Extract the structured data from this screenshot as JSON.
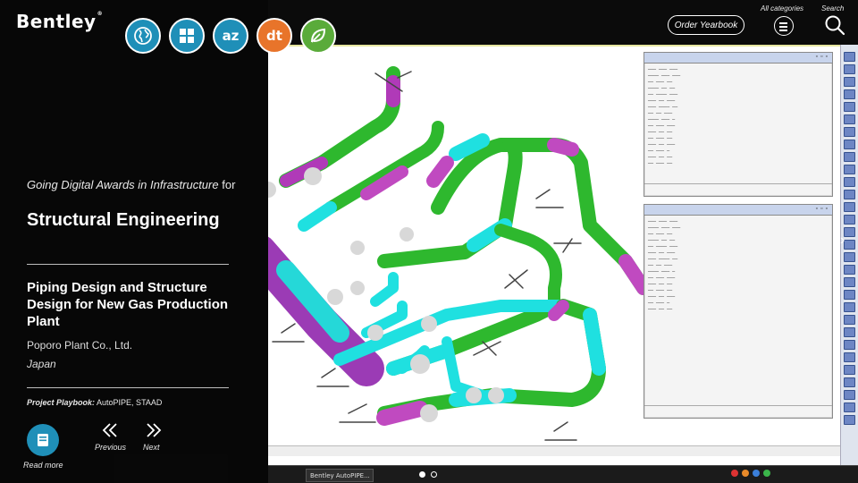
{
  "brand": {
    "name": "Bentley",
    "mark": "®"
  },
  "icons": {
    "globe": "globe-icon",
    "grid": "grid-icon",
    "az": "az-index-icon",
    "dt": "digital-twin-icon",
    "leaf": "leaf-icon"
  },
  "icon_text": {
    "az": "az",
    "dt": "dt"
  },
  "colors": {
    "accent_blue": "#1f8fb8",
    "accent_orange": "#e8742a",
    "accent_green": "#5aab3a",
    "panel": "#000000"
  },
  "header": {
    "order_label": "Order Yearbook",
    "categories_label": "All categories",
    "search_label": "Search"
  },
  "award": {
    "lead_italic": "Going Digital Awards in Infrastructure",
    "lead_for": " for",
    "category": "Structural Engineering"
  },
  "project": {
    "title": "Piping Design and Structure Design for New Gas Production Plant",
    "company": "Poporo Plant Co., Ltd.",
    "country": "Japan",
    "playbook_label": "Project Playbook:",
    "playbook_value": " AutoPIPE, STAAD"
  },
  "nav": {
    "read_more": "Read more",
    "previous": "Previous",
    "next": "Next"
  },
  "pager": {
    "count": 2,
    "active": 1
  },
  "taskbar": {
    "item": "Bentley AutoPIPE..."
  }
}
